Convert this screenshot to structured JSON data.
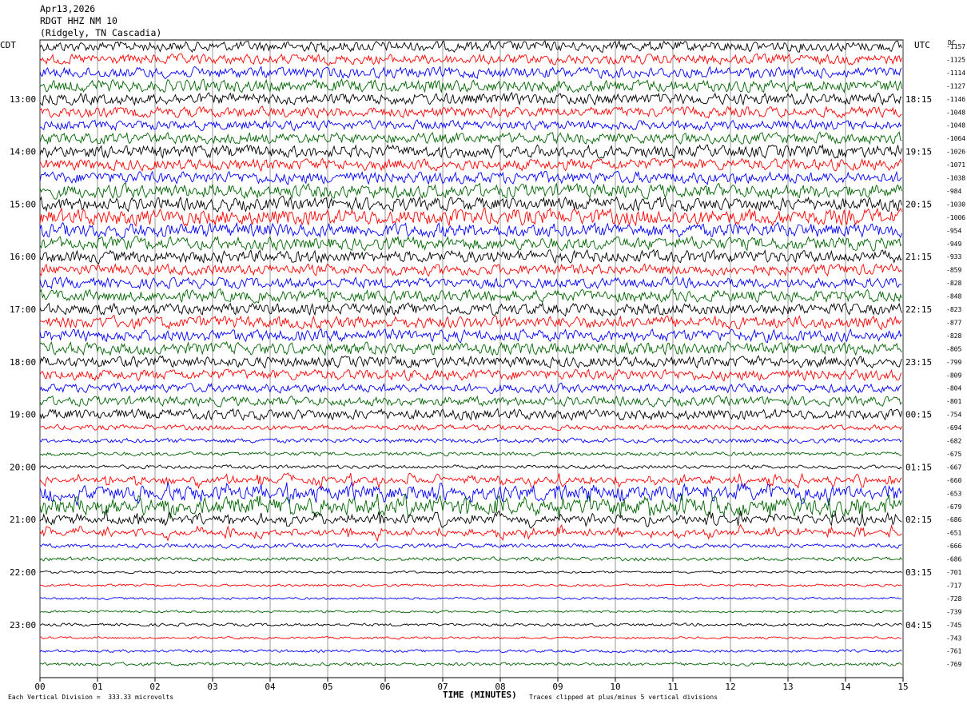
{
  "header": {
    "date": "Apr13,2026",
    "station": "RDGT HHZ NM 10",
    "location": "(Ridgely, TN Cascadia)"
  },
  "left_zone_label": "CDT",
  "right_zone_label": "UTC",
  "dc_header": "DC",
  "footer": {
    "scale_note": "Each Vertical Division =  333.33 microvolts",
    "x_axis_title": "TIME (MINUTES)",
    "clip_note": "Traces clipped at plus/minus 5 vertical divisions"
  },
  "colors": {
    "black": "#000000",
    "red": "#ff0000",
    "blue": "#0000ff",
    "green": "#006400",
    "grid": "#555555"
  },
  "chart_data": {
    "type": "line",
    "subtype": "helicorder",
    "xlabel": "TIME (MINUTES)",
    "xlim": [
      0,
      15
    ],
    "x_ticks": [
      "00",
      "01",
      "02",
      "03",
      "04",
      "05",
      "06",
      "07",
      "08",
      "09",
      "10",
      "11",
      "12",
      "13",
      "14",
      "15"
    ],
    "trace_color_cycle": [
      "black",
      "red",
      "blue",
      "green"
    ],
    "hour_labels_left": [
      "13:00",
      "14:00",
      "15:00",
      "16:00",
      "17:00",
      "18:00",
      "19:00",
      "20:00",
      "21:00",
      "22:00",
      "23:00"
    ],
    "hour_labels_right": [
      "18:15",
      "19:15",
      "20:15",
      "21:15",
      "22:15",
      "23:15",
      "00:15",
      "01:15",
      "02:15",
      "03:15",
      "04:15"
    ],
    "trace_dc_offsets": [
      -1157,
      -1125,
      -1114,
      -1127,
      -1146,
      -1048,
      -1048,
      -1064,
      -1026,
      -1071,
      -1038,
      -984,
      -1030,
      -1006,
      -954,
      -949,
      -933,
      -859,
      -828,
      -848,
      -823,
      -877,
      -828,
      -805,
      -799,
      -809,
      -804,
      -801,
      -754,
      -694,
      -682,
      -675,
      -667,
      -660,
      -653,
      -679,
      -686,
      -651,
      -666,
      -686,
      -701,
      -717,
      -728,
      -739,
      -745,
      -743,
      -761,
      -769
    ],
    "trace_activity": [
      2.2,
      2.1,
      2.3,
      2.6,
      2.4,
      2.2,
      2.0,
      2.3,
      2.6,
      2.4,
      2.5,
      2.9,
      2.8,
      3.4,
      3.0,
      2.7,
      2.6,
      2.3,
      2.2,
      2.5,
      2.4,
      2.6,
      2.5,
      2.6,
      2.3,
      2.2,
      1.9,
      2.0,
      2.2,
      1.1,
      1.0,
      0.8,
      0.8,
      1.2,
      2.8,
      3.4,
      1.6,
      1.1,
      0.9,
      0.8,
      0.5,
      0.5,
      0.5,
      0.5,
      0.6,
      0.5,
      0.6,
      0.7
    ]
  }
}
